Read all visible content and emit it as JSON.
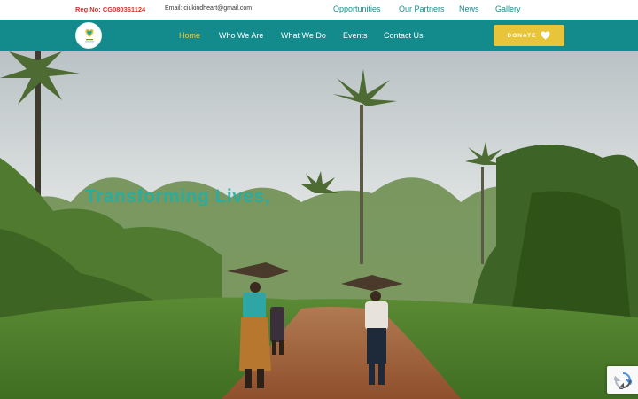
{
  "topbar": {
    "reg": "Reg No: CG080361124",
    "email": "Email: ciukindheart@gmail.com",
    "links": [
      "Opportunities",
      "Our Partners",
      "News",
      "Gallery"
    ]
  },
  "nav": {
    "logo_text": "CIU KIND HEART",
    "items": [
      "Home",
      "Who We Are",
      "What We Do",
      "Events",
      "Contact Us"
    ],
    "active": "Home",
    "donate_label": "DONATE"
  },
  "hero": {
    "headline": "Transforming Lives,"
  },
  "icons": {
    "logo": "ciu-kind-heart-logo",
    "donate": "heart-icon",
    "recaptcha": "recaptcha-icon"
  },
  "colors": {
    "brand_teal": "#138a8c",
    "accent_yellow": "#e8c43a",
    "reg_red": "#d6322f",
    "active_nav": "#f0cf3a",
    "link_teal": "#1a8c8c"
  }
}
